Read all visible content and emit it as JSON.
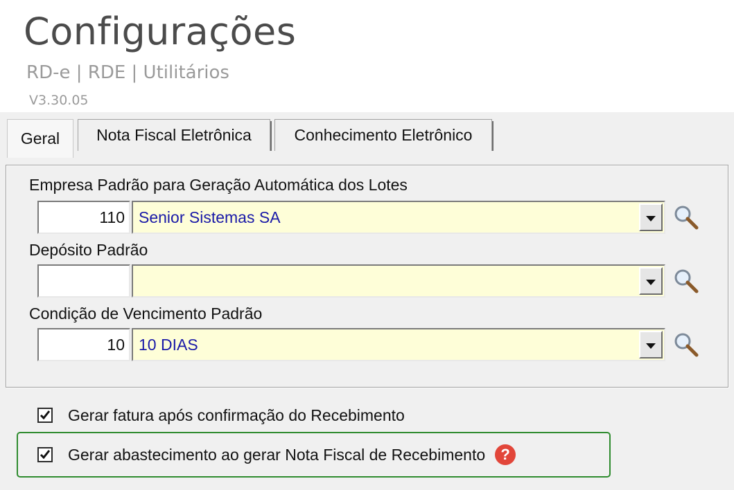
{
  "header": {
    "title": "Configurações",
    "subtitle": "RD-e | RDE | Utilitários",
    "version": "V3.30.05"
  },
  "tabs": [
    {
      "label": "Geral",
      "active": true
    },
    {
      "label": "Nota Fiscal Eletrônica",
      "active": false
    },
    {
      "label": "Conhecimento Eletrônico",
      "active": false
    }
  ],
  "fields": [
    {
      "label": "Empresa Padrão para Geração  Automática dos Lotes",
      "code": "110",
      "value": "Senior Sistemas SA"
    },
    {
      "label": "Depósito Padrão",
      "code": "",
      "value": ""
    },
    {
      "label": "Condição de Vencimento Padrão",
      "code": "10",
      "value": "10 DIAS"
    }
  ],
  "options": [
    {
      "label": "Gerar fatura após confirmação do Recebimento",
      "checked": true
    },
    {
      "label": "Gerar abastecimento ao gerar Nota Fiscal de Recebimento",
      "checked": true,
      "help_icon": "help-icon"
    }
  ],
  "colors": {
    "combo_background": "#fefed8",
    "combo_text": "#1a1aa8",
    "highlight_border": "#2e8b2e",
    "help_icon": "#e2463a"
  }
}
